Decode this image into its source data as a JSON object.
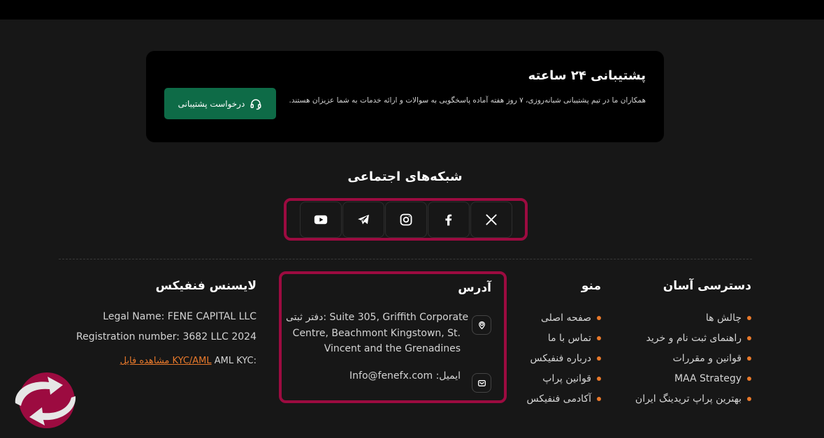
{
  "support": {
    "title": "پشتیبانی ۲۴ ساعته",
    "description": "همکاران ما در تیم پشتیبانی شبانه‌روزی، ۷ روز هفته آماده پاسخگویی به سوالات و ارائه خدمات به شما عزیزان هستند.",
    "button_label": "درخواست پشتیبانی"
  },
  "social": {
    "title": "شبکه‌های اجتماعی",
    "icons": [
      "youtube-icon",
      "telegram-icon",
      "instagram-icon",
      "facebook-icon",
      "x-icon"
    ]
  },
  "quick_access": {
    "title": "دسترسی آسان",
    "items": [
      "چالش ها",
      "راهنمای ثبت نام و خرید",
      "قوانین و مقررات",
      "MAA Strategy",
      "بهترین پراپ تریدینگ ایران"
    ]
  },
  "menu": {
    "title": "منو",
    "items": [
      "صفحه اصلی",
      "تماس با ما",
      "درباره فنفیکس",
      "قوانین پراپ",
      "آکادمی فنفیکس"
    ]
  },
  "address": {
    "title": "آدرس",
    "registered_label": "دفتر ثبتی:",
    "registered_line1": "Suite 305, Griffith Corporate",
    "registered_line2": "Centre, Beachmont Kingstown, St.",
    "registered_line3": "Vincent and the Grenadines",
    "email_label": "ایمیل:",
    "email_value": "Info@fenefx.com"
  },
  "license": {
    "title": "لایسنس فنفیکس",
    "legal_name": "Legal Name: FENE CAPITAL LLC",
    "registration": "Registration number: 3682 LLC 2024",
    "kyc_prefix": "AML KYC:",
    "kyc_link": "مشاهده فایل KYC/AML"
  },
  "colors": {
    "accent": "#e8792b",
    "highlight_border": "#9c0b40",
    "button_green": "#0e6b47",
    "background": "#171717"
  }
}
